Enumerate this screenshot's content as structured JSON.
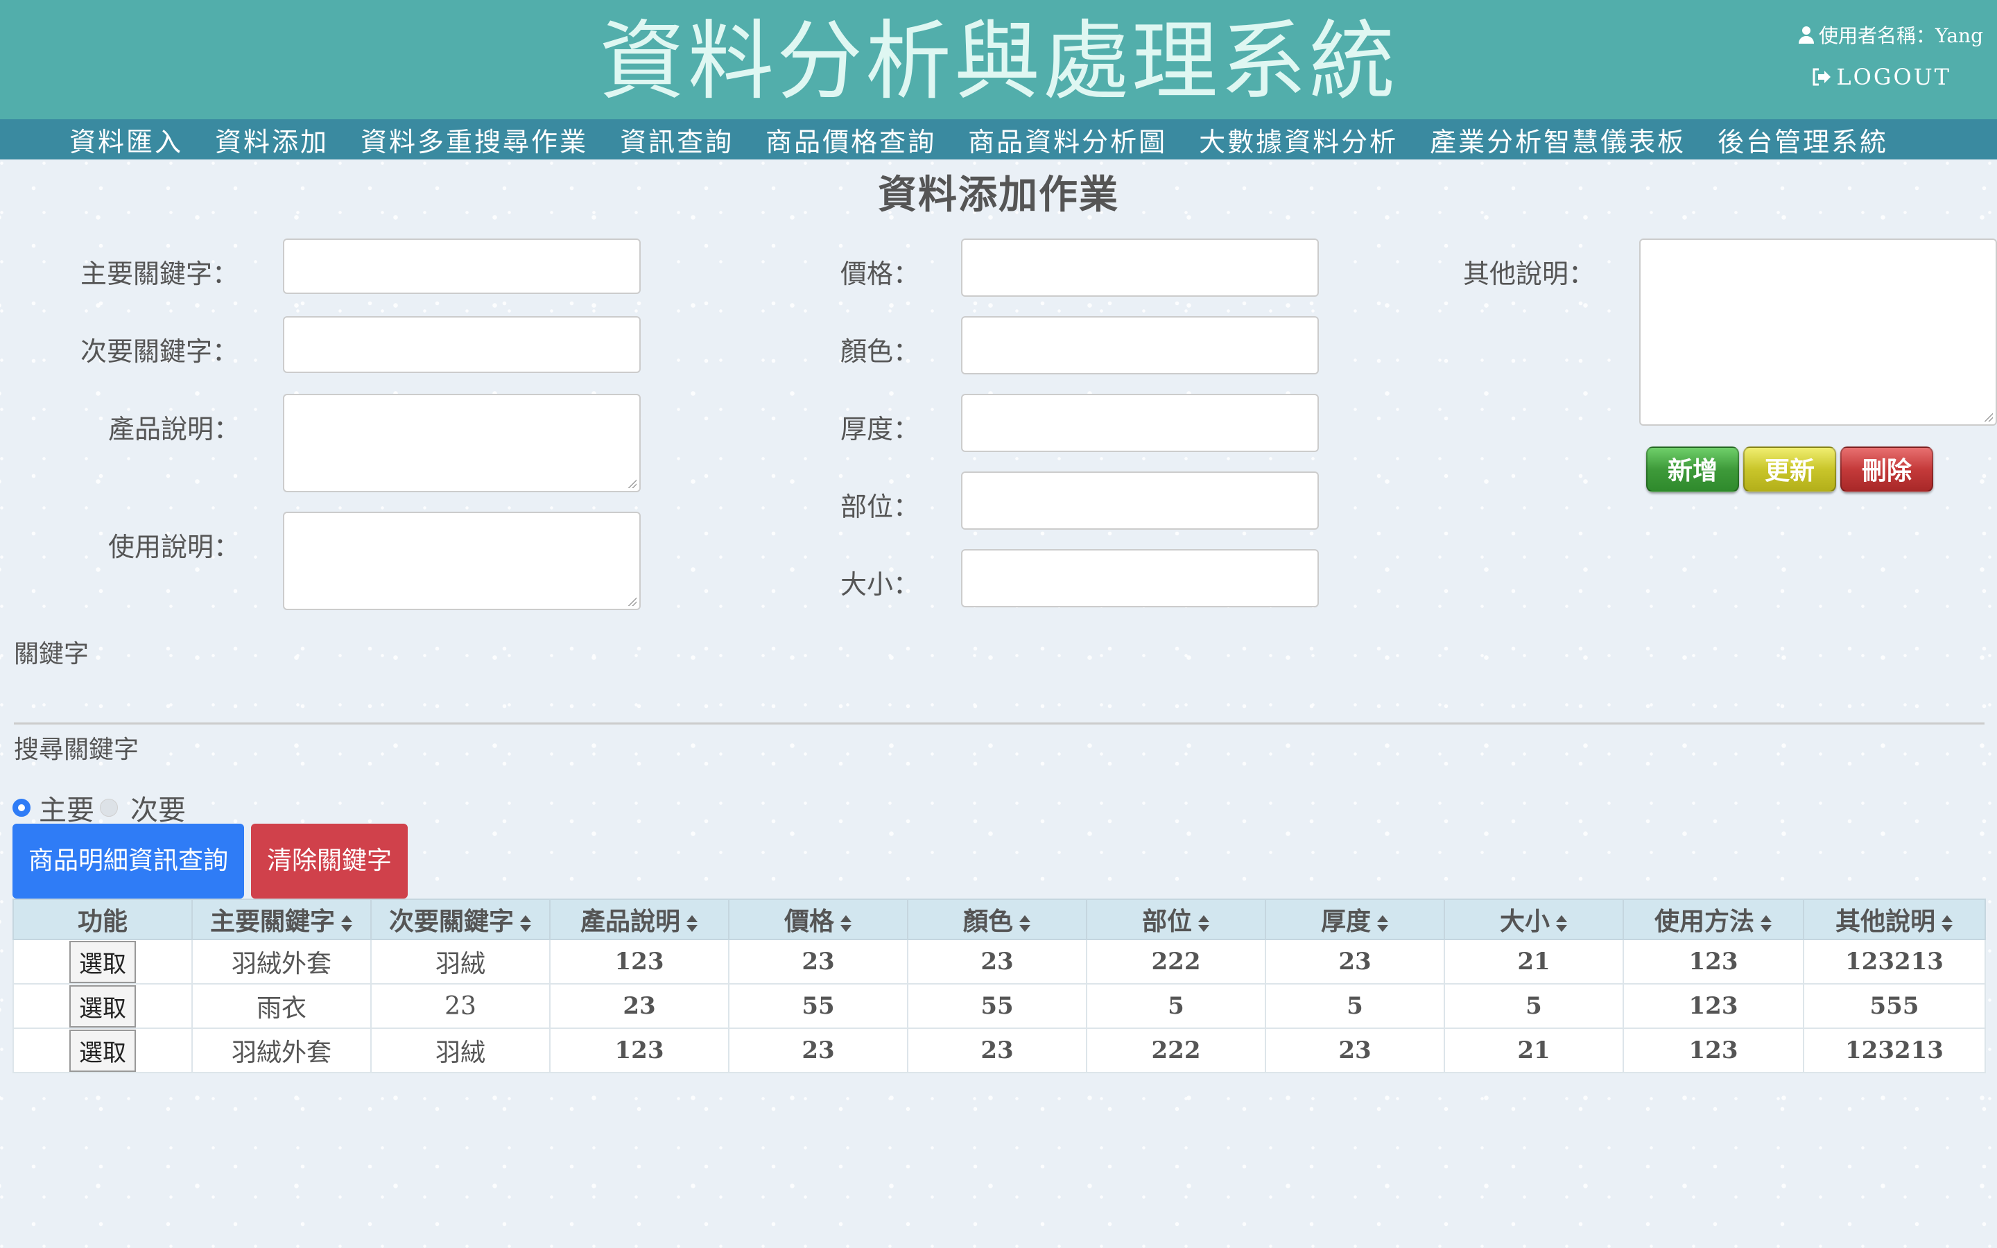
{
  "app_title": "資料分析與處理系統",
  "user": {
    "label": "使用者名稱：Yang",
    "logout": "LOGOUT"
  },
  "nav": [
    "資料匯入",
    "資料添加",
    "資料多重搜尋作業",
    "資訊查詢",
    "商品價格查詢",
    "商品資料分析圖",
    "大數據資料分析",
    "產業分析智慧儀表板",
    "後台管理系統"
  ],
  "page_title": "資料添加作業",
  "form": {
    "main_keyword": "主要關鍵字：",
    "sub_keyword": "次要關鍵字：",
    "product_desc": "產品說明：",
    "usage_desc": "使用說明：",
    "price": "價格：",
    "color": "顏色：",
    "thickness": "厚度：",
    "part": "部位：",
    "size": "大小：",
    "other": "其他說明："
  },
  "actions": {
    "add": "新增",
    "update": "更新",
    "delete": "刪除"
  },
  "keyword_section": "關鍵字",
  "search_section": "搜尋關鍵字",
  "radios": {
    "main": "主要",
    "sub": "次要"
  },
  "buttons": {
    "query": "商品明細資訊查詢",
    "clear": "清除關鍵字"
  },
  "table": {
    "headers": [
      "功能",
      "主要關鍵字",
      "次要關鍵字",
      "產品說明",
      "價格",
      "顏色",
      "部位",
      "厚度",
      "大小",
      "使用方法",
      "其他說明"
    ],
    "select_label": "選取",
    "rows": [
      [
        "羽絨外套",
        "羽絨",
        "123",
        "23",
        "23",
        "222",
        "23",
        "21",
        "123",
        "123213"
      ],
      [
        "雨衣",
        "23",
        "23",
        "55",
        "55",
        "5",
        "5",
        "5",
        "123",
        "555"
      ],
      [
        "羽絨外套",
        "羽絨",
        "123",
        "23",
        "23",
        "222",
        "23",
        "21",
        "123",
        "123213"
      ]
    ]
  },
  "colors": {
    "header": "#52aeab",
    "nav": "#3a8aa0",
    "primary": "#2f7cf6",
    "danger": "#d0414b"
  }
}
